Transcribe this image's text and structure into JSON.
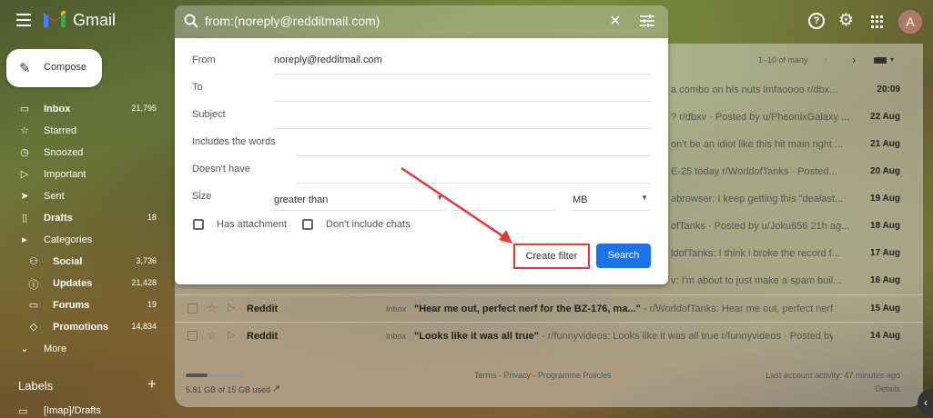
{
  "topbar": {
    "brand": "Gmail",
    "search_query": "from:(noreply@redditmail.com)",
    "avatar_letter": "A"
  },
  "sidebar": {
    "compose_label": "Compose",
    "items": [
      {
        "label": "Inbox",
        "count": "21,795",
        "icon": "inbox-icon",
        "bold": true
      },
      {
        "label": "Starred",
        "count": "",
        "icon": "star-icon",
        "bold": false
      },
      {
        "label": "Snoozed",
        "count": "",
        "icon": "clock-icon",
        "bold": false
      },
      {
        "label": "Important",
        "count": "",
        "icon": "important-icon",
        "bold": false
      },
      {
        "label": "Sent",
        "count": "",
        "icon": "send-icon",
        "bold": false
      },
      {
        "label": "Drafts",
        "count": "18",
        "icon": "draft-icon",
        "bold": true
      },
      {
        "label": "Categories",
        "count": "",
        "icon": "caret-icon",
        "bold": false
      },
      {
        "label": "Social",
        "count": "3,736",
        "icon": "people-icon",
        "bold": true,
        "sub": true
      },
      {
        "label": "Updates",
        "count": "21,428",
        "icon": "info-icon",
        "bold": true,
        "sub": true
      },
      {
        "label": "Forums",
        "count": "19",
        "icon": "forum-icon",
        "bold": true,
        "sub": true
      },
      {
        "label": "Promotions",
        "count": "14,834",
        "icon": "tag-icon",
        "bold": true,
        "sub": true
      },
      {
        "label": "More",
        "count": "",
        "icon": "expand-icon",
        "bold": false
      }
    ],
    "labels_header": "Labels",
    "label_items": [
      "[Imap]/Drafts"
    ]
  },
  "list": {
    "pager": "1–10 of many",
    "right_snippets": [
      {
        "text": "a combo on his nuts lmfaoooo r/dbx...",
        "date": "20:09"
      },
      {
        "text": "? r/dbxv · Posted by u/PheonixGalaxy ...",
        "date": "22 Aug"
      },
      {
        "text": "on't be an idiot like this hit main right ...",
        "date": "21 Aug"
      },
      {
        "text": "E-25 today r/WorldofTanks · Posted...",
        "date": "20 Aug"
      },
      {
        "text": "abrowser: I keep getting this \"dealast...",
        "date": "19 Aug"
      },
      {
        "text": "ofTanks · Posted by u/Joku656 21h ag...",
        "date": "18 Aug"
      },
      {
        "text": "ldofTanks: I think i broke the record f...",
        "date": "17 Aug"
      },
      {
        "text": "v: I'm about to just make a spam buil...",
        "date": "16 Aug"
      }
    ],
    "rows": [
      {
        "sender": "Reddit",
        "tag": "Inbox",
        "subject": "\"Hear me out, perfect nerf for the BZ-176, ma...\"",
        "snippet": " - r/WorldofTanks: Hear me out, perfect nerf ...",
        "date": "15 Aug"
      },
      {
        "sender": "Reddit",
        "tag": "Inbox",
        "subject": "\"Looks like it was all true\"",
        "snippet": " - r/funnyvideos: Looks like it was all true r/funnyvideos · Posted by u...",
        "date": "14 Aug"
      }
    ],
    "storage": "5.81 GB of 15 GB used",
    "storage_fraction": 0.387,
    "footer_links": "Terms · Privacy · Programme Policies",
    "last_activity": "Last account activity: 47 minutes ago",
    "details": "Details"
  },
  "dialog": {
    "from_label": "From",
    "from_value": "noreply@redditmail.com",
    "to_label": "To",
    "subject_label": "Subject",
    "includes_label": "Includes the words",
    "doesnt_have_label": "Doesn't have",
    "size_label": "Size",
    "size_op": "greater than",
    "size_unit": "MB",
    "has_attachment": "Has attachment",
    "dont_include_chats": "Don't include chats",
    "create_filter": "Create filter",
    "search": "Search"
  },
  "colors": {
    "accent_blue": "#1a73e8",
    "highlight_red": "#e53935"
  }
}
